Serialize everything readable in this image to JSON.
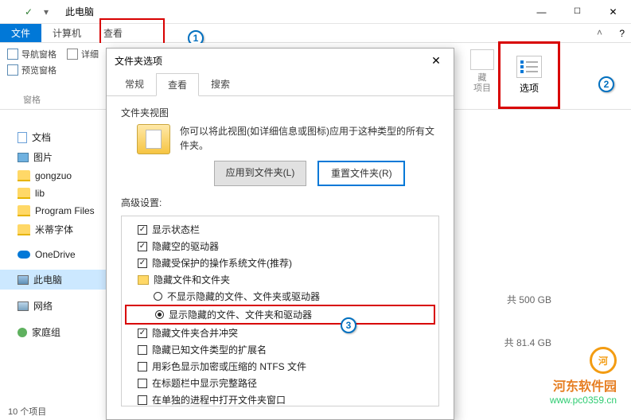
{
  "window": {
    "title": "此电脑"
  },
  "tabs": {
    "file": "文件",
    "computer": "计算机",
    "view": "查看"
  },
  "ribbon": {
    "nav_pane": "导航窗格",
    "preview_pane": "预览窗格",
    "details_label": "详细",
    "panes_group": "窗格",
    "hidden_group": "藏\n项目",
    "options_label": "选项"
  },
  "tree": {
    "items": [
      "文档",
      "图片",
      "gongzuo",
      "lib",
      "Program Files",
      "米蒂字体",
      "OneDrive",
      "此电脑",
      "网络",
      "家庭组"
    ]
  },
  "footer": "10 个项目",
  "disks": {
    "d1": "共 500 GB",
    "d2": "共 81.4 GB"
  },
  "dialog": {
    "title": "文件夹选项",
    "tabs": {
      "general": "常规",
      "view": "查看",
      "search": "搜索"
    },
    "folder_view_label": "文件夹视图",
    "folder_view_text": "你可以将此视图(如详细信息或图标)应用于这种类型的所有文件夹。",
    "apply_btn": "应用到文件夹(L)",
    "reset_btn": "重置文件夹(R)",
    "advanced_label": "高级设置:",
    "opts": [
      {
        "kind": "check",
        "checked": true,
        "label": "显示状态栏"
      },
      {
        "kind": "check",
        "checked": true,
        "label": "隐藏空的驱动器"
      },
      {
        "kind": "check",
        "checked": true,
        "label": "隐藏受保护的操作系统文件(推荐)"
      },
      {
        "kind": "folder",
        "label": "隐藏文件和文件夹"
      },
      {
        "kind": "radio",
        "checked": false,
        "indent": true,
        "label": "不显示隐藏的文件、文件夹或驱动器"
      },
      {
        "kind": "radio",
        "checked": true,
        "indent": true,
        "label": "显示隐藏的文件、文件夹和驱动器",
        "highlight": true
      },
      {
        "kind": "check",
        "checked": true,
        "label": "隐藏文件夹合并冲突"
      },
      {
        "kind": "check",
        "checked": false,
        "label": "隐藏已知文件类型的扩展名"
      },
      {
        "kind": "check",
        "checked": false,
        "label": "用彩色显示加密或压缩的 NTFS 文件"
      },
      {
        "kind": "check",
        "checked": false,
        "label": "在标题栏中显示完整路径"
      },
      {
        "kind": "check",
        "checked": false,
        "label": "在单独的进程中打开文件夹窗口"
      }
    ]
  },
  "watermark": {
    "site": "河东软件园",
    "url": "www.pc0359.cn"
  }
}
